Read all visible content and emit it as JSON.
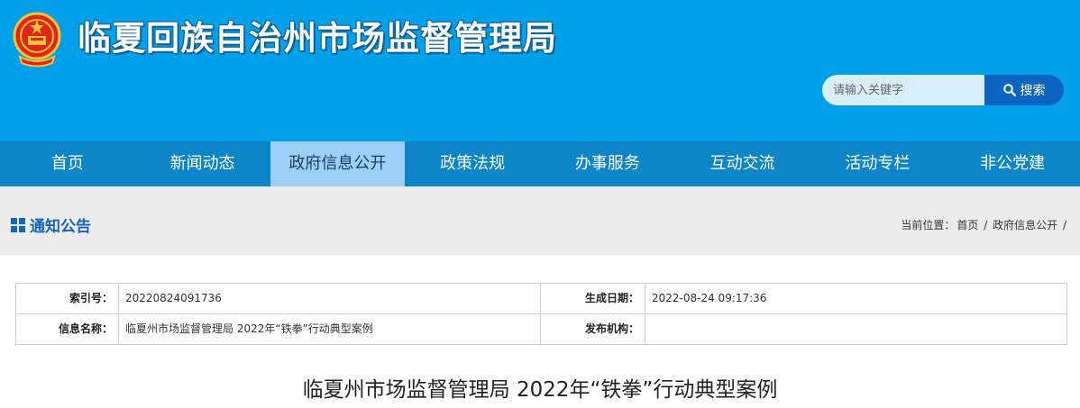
{
  "header": {
    "site_title": "临夏回族自治州市场监督管理局",
    "search_placeholder": "请输入关键字",
    "search_button": "搜索"
  },
  "nav": {
    "items": [
      "首页",
      "新闻动态",
      "政府信息公开",
      "政策法规",
      "办事服务",
      "互动交流",
      "活动专栏",
      "非公党建"
    ],
    "active": "政府信息公开"
  },
  "section": {
    "title": "通知公告",
    "breadcrumb_prefix": "当前位置：",
    "breadcrumb_home": "首页",
    "breadcrumb_current": "政府信息公开",
    "breadcrumb_sep": "/"
  },
  "info": {
    "index_label": "索引号：",
    "index_value": "20220824091736",
    "date_label": "生成日期：",
    "date_value": "2022-08-24 09:17:36",
    "name_label": "信息名称：",
    "name_value": "临夏州市场监督管理局 2022年“铁拳”行动典型案例",
    "publisher_label": "发布机构：",
    "publisher_value": ""
  },
  "article": {
    "title": "临夏州市场监督管理局 2022年“铁拳”行动典型案例"
  },
  "colors": {
    "header_bg": "#02a0e8",
    "nav_bg": "#0d86c9",
    "nav_active_bg": "#9cd0f6",
    "search_button_bg": "#0b64c0",
    "section_title": "#1565c0"
  },
  "icons": {
    "emblem": "national-emblem-icon",
    "search": "search-icon",
    "section": "grid-icon"
  }
}
